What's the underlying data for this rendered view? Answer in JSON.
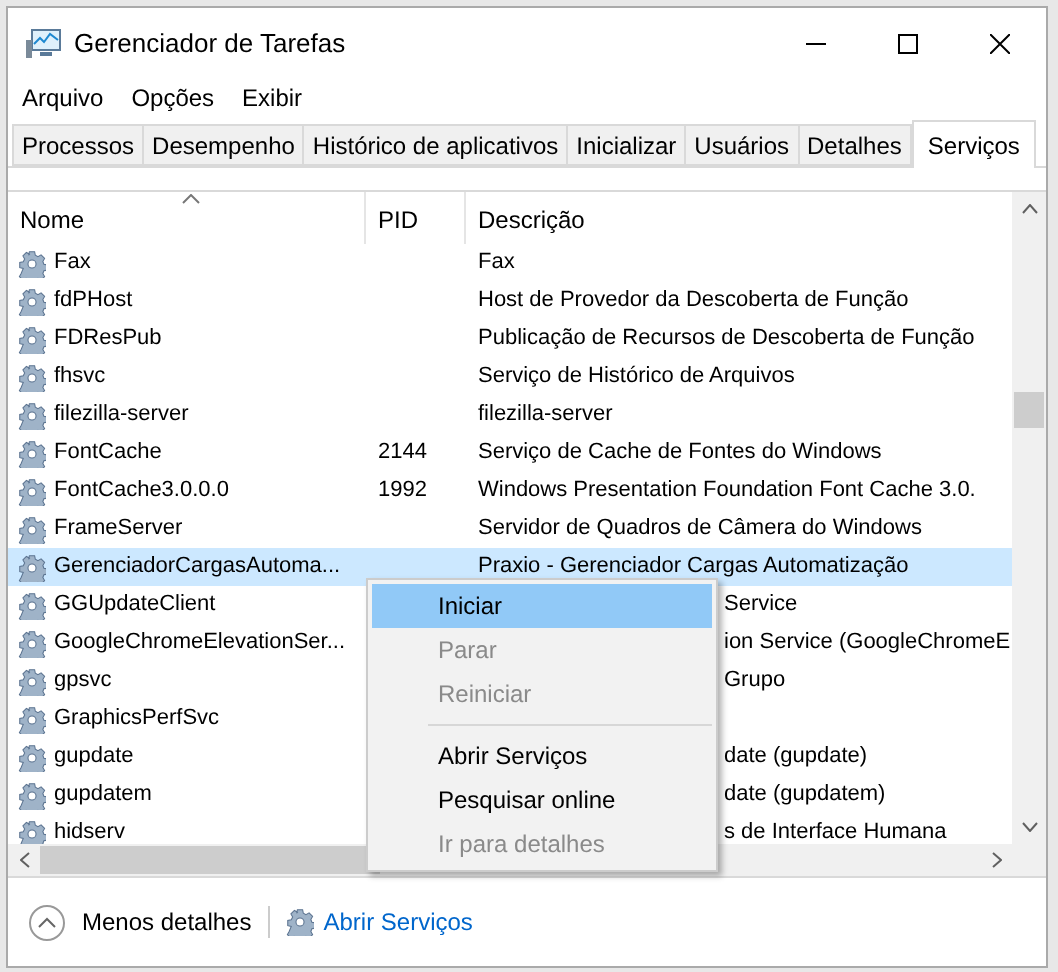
{
  "window": {
    "title": "Gerenciador de Tarefas"
  },
  "menu_bar": [
    "Arquivo",
    "Opções",
    "Exibir"
  ],
  "tabs": [
    {
      "label": "Processos",
      "selected": false
    },
    {
      "label": "Desempenho",
      "selected": false
    },
    {
      "label": "Histórico de aplicativos",
      "selected": false
    },
    {
      "label": "Inicializar",
      "selected": false
    },
    {
      "label": "Usuários",
      "selected": false
    },
    {
      "label": "Detalhes",
      "selected": false
    },
    {
      "label": "Serviços",
      "selected": true
    }
  ],
  "table": {
    "columns": [
      "Nome",
      "PID",
      "Descrição"
    ],
    "rows": [
      {
        "name": "Fax",
        "description": "Fax",
        "selected": false,
        "covered": false
      },
      {
        "name": "fdPHost",
        "description": "Host de Provedor da Descoberta de Função",
        "selected": false,
        "covered": false
      },
      {
        "name": "FDResPub",
        "description": "Publicação de Recursos de Descoberta de Função",
        "selected": false,
        "covered": false
      },
      {
        "name": "fhsvc",
        "description": "Serviço de Histórico de Arquivos",
        "selected": false,
        "covered": false
      },
      {
        "name": "filezilla-server",
        "description": "filezilla-server",
        "selected": false,
        "covered": false
      },
      {
        "name": "FontCache",
        "pid": "2144",
        "description": "Serviço de Cache de Fontes do Windows",
        "selected": false,
        "covered": false
      },
      {
        "name": "FontCache3.0.0.0",
        "pid": "1992",
        "description": "Windows Presentation Foundation Font Cache 3.0.",
        "selected": false,
        "covered": false
      },
      {
        "name": "FrameServer",
        "description": "Servidor de Quadros de Câmera do Windows",
        "selected": false,
        "covered": false
      },
      {
        "name": "GerenciadorCargasAutoma...",
        "description": "Praxio - Gerenciador Cargas Automatização",
        "selected": true,
        "covered": false
      },
      {
        "name": "GGUpdateClient",
        "description": "Service",
        "selected": false,
        "covered": true
      },
      {
        "name": "GoogleChromeElevationSer...",
        "description": "ion Service (GoogleChromeE",
        "selected": false,
        "covered": true
      },
      {
        "name": "gpsvc",
        "description": "Grupo",
        "selected": false,
        "covered": true
      },
      {
        "name": "GraphicsPerfSvc",
        "selected": false
      },
      {
        "name": "gupdate",
        "description": "date (gupdate)",
        "selected": false,
        "covered": true
      },
      {
        "name": "gupdatem",
        "description": "date (gupdatem)",
        "selected": false,
        "covered": true
      },
      {
        "name": "hidserv",
        "description": "s de Interface Humana",
        "selected": false,
        "covered": true
      }
    ]
  },
  "context_menu": [
    {
      "kind": "item",
      "label": "Iniciar",
      "selected": true,
      "disabled": false
    },
    {
      "kind": "item",
      "label": "Parar",
      "selected": false,
      "disabled": true
    },
    {
      "kind": "item",
      "label": "Reiniciar",
      "selected": false,
      "disabled": true
    },
    {
      "kind": "separator"
    },
    {
      "kind": "item",
      "label": "Abrir Serviços",
      "selected": false,
      "disabled": false
    },
    {
      "kind": "item",
      "label": "Pesquisar online",
      "selected": false,
      "disabled": false
    },
    {
      "kind": "item",
      "label": "Ir para detalhes",
      "selected": false,
      "disabled": true
    }
  ],
  "footer": {
    "less_details": "Menos detalhes",
    "open_services": "Abrir Serviços"
  }
}
